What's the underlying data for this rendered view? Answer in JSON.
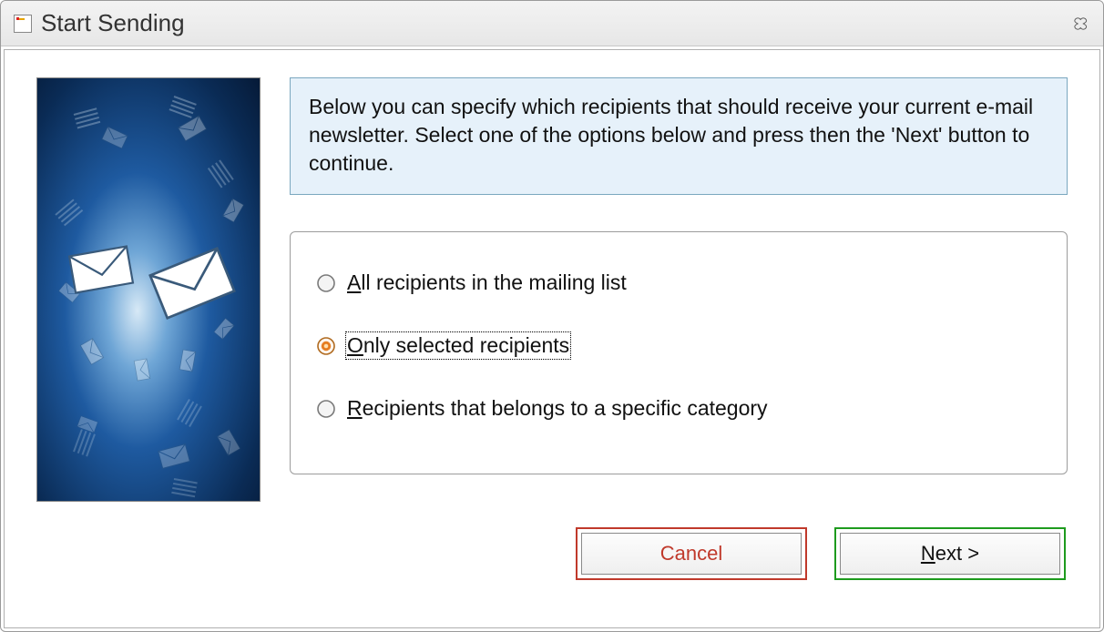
{
  "window": {
    "title": "Start Sending"
  },
  "info": "Below you can specify which recipients that should receive your current e-mail newsletter. Select one of the options below and press then the 'Next' button to continue.",
  "options": [
    {
      "id": "all",
      "label_prefix": "",
      "label_u": "A",
      "label_rest": "ll recipients in the mailing list",
      "selected": false
    },
    {
      "id": "selected",
      "label_prefix": "",
      "label_u": "O",
      "label_rest": "nly selected recipients",
      "selected": true
    },
    {
      "id": "category",
      "label_prefix": "",
      "label_u": "R",
      "label_rest": "ecipients that belongs to a specific category",
      "selected": false
    }
  ],
  "buttons": {
    "cancel": "Cancel",
    "next_u": "N",
    "next_rest": "ext >"
  }
}
